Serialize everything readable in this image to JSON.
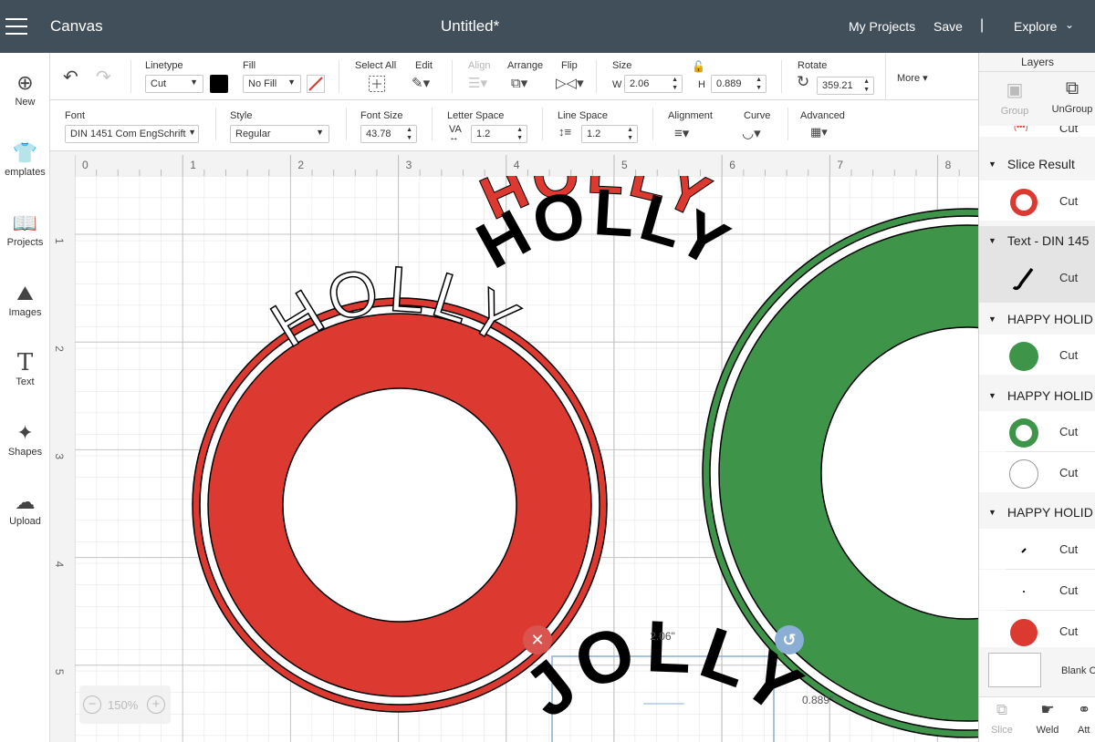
{
  "topbar": {
    "app_title": "Canvas",
    "doc_title": "Untitled*",
    "my_projects": "My Projects",
    "save": "Save",
    "separator": "|",
    "explore": "Explore"
  },
  "toolbar_row1": {
    "linetype_label": "Linetype",
    "linetype_value": "Cut",
    "fill_label": "Fill",
    "fill_value": "No Fill",
    "select_all_label": "Select All",
    "edit_label": "Edit",
    "align_label": "Align",
    "arrange_label": "Arrange",
    "flip_label": "Flip",
    "size_label": "Size",
    "w_label": "W",
    "w_value": "2.06",
    "h_label": "H",
    "h_value": "0.889",
    "rotate_label": "Rotate",
    "rotate_value": "359.21",
    "more_label": "More"
  },
  "toolbar_row2": {
    "font_label": "Font",
    "font_value": "DIN 1451 Com EngSchrift",
    "style_label": "Style",
    "style_value": "Regular",
    "font_size_label": "Font Size",
    "font_size_value": "43.78",
    "letter_space_label": "Letter Space",
    "letter_space_icon": "VA",
    "letter_space_value": "1.2",
    "line_space_label": "Line Space",
    "line_space_value": "1.2",
    "alignment_label": "Alignment",
    "curve_label": "Curve",
    "advanced_label": "Advanced"
  },
  "sidebar": {
    "items": [
      {
        "label": "New",
        "icon": "plus-circle-icon"
      },
      {
        "label": "emplates",
        "icon": "tshirt-icon"
      },
      {
        "label": "Projects",
        "icon": "book-icon"
      },
      {
        "label": "Images",
        "icon": "image-icon"
      },
      {
        "label": "Text",
        "icon": "text-t-icon"
      },
      {
        "label": "Shapes",
        "icon": "shapes-icon"
      },
      {
        "label": "Upload",
        "icon": "cloud-upload-icon"
      }
    ]
  },
  "rulers": {
    "h_ticks": [
      "0",
      "1",
      "2",
      "3",
      "4",
      "5",
      "6",
      "7",
      "8"
    ],
    "v_ticks": [
      "1",
      "2",
      "3",
      "4",
      "5"
    ]
  },
  "canvas": {
    "holly_ring_text": "HOLLY",
    "floating_holly_red": "HOLLY",
    "floating_holly_black": "HOLLY",
    "jolly_text": "JOLLY",
    "width_readout": "2.06\"",
    "height_readout": "0.889\"",
    "zoom_level": "150%",
    "zoom_minus": "−",
    "zoom_plus": "+",
    "colors": {
      "red": "#dc3a31",
      "green": "#3e9449",
      "black": "#000000",
      "grid": "#dedede",
      "grid_major": "#bdbdbd"
    }
  },
  "layers": {
    "title": "Layers",
    "group_label": "Group",
    "ungroup_label": "UnGroup",
    "top_partial_cut": "Cut",
    "groups": [
      {
        "name": "Slice Result",
        "rows": [
          {
            "label": "Cut",
            "thumb": "red-ring-thumb"
          }
        ]
      },
      {
        "name": "Text - DIN 145",
        "rows": [
          {
            "label": "Cut",
            "thumb": "black-stroke-thumb"
          }
        ]
      },
      {
        "name": "HAPPY HOLID",
        "rows": [
          {
            "label": "Cut",
            "thumb": "green-circle-thumb"
          }
        ]
      },
      {
        "name": "HAPPY HOLID",
        "rows": [
          {
            "label": "Cut",
            "thumb": "green-ring-thumb"
          },
          {
            "label": "Cut",
            "thumb": "white-circle-thumb"
          }
        ]
      },
      {
        "name": "HAPPY HOLID",
        "rows": [
          {
            "label": "Cut",
            "thumb": "dot-thumb"
          },
          {
            "label": "Cut",
            "thumb": "small-dot-thumb"
          },
          {
            "label": "Cut",
            "thumb": "red-circle-thumb"
          }
        ]
      }
    ],
    "blank_canvas_label": "Blank C",
    "bottom_actions": [
      "Slice",
      "Weld",
      "Att"
    ]
  }
}
